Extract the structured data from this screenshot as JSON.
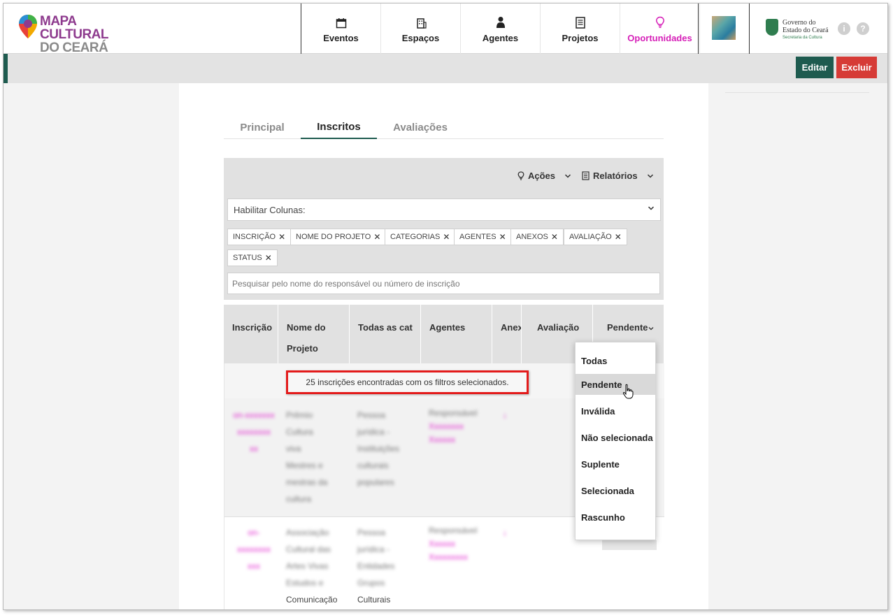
{
  "header": {
    "logo": {
      "line1": "MAPA CULTURAL",
      "line2": "DO CEARÁ"
    },
    "nav": [
      {
        "label": "Eventos",
        "icon": "calendar-icon"
      },
      {
        "label": "Espaços",
        "icon": "building-icon"
      },
      {
        "label": "Agentes",
        "icon": "person-icon"
      },
      {
        "label": "Projetos",
        "icon": "document-icon"
      },
      {
        "label": "Oportunidades",
        "icon": "lightbulb-icon",
        "active": true
      }
    ],
    "gov": {
      "line1": "Governo do",
      "line2": "Estado do Ceará",
      "line3": "Secretaria da Cultura"
    },
    "info_icon": "i",
    "help_icon": "?"
  },
  "actions": {
    "edit": "Editar",
    "delete": "Excluir"
  },
  "tabs": [
    {
      "label": "Principal"
    },
    {
      "label": "Inscritos",
      "active": true
    },
    {
      "label": "Avaliações"
    }
  ],
  "toolbar": {
    "actions": "Ações",
    "reports": "Relatórios"
  },
  "filters": {
    "columns_select": "Habilitar Colunas:",
    "chips": [
      "INSCRIÇÃO",
      "NOME DO PROJETO",
      "CATEGORIAS",
      "AGENTES",
      "ANEXOS",
      "AVALIAÇÃO",
      "STATUS"
    ],
    "search_placeholder": "Pesquisar pelo nome do responsável ou número de inscrição"
  },
  "table": {
    "headers": [
      "Inscrição",
      "Nome do Projeto",
      "Todas as cat",
      "Agentes",
      "Anex",
      "Avaliação",
      "Pendente"
    ],
    "result_text": "25 inscrições encontradas com os filtros selecionados.",
    "rows": [
      {
        "inscricao": [
          "on-xxxxxxx",
          "xxxxxxxx",
          "xx"
        ],
        "projeto": [
          "Prêmio",
          "Cultura",
          "viva",
          "Mestres e",
          "mestras da",
          "cultura"
        ],
        "categoria": [
          "Pessoa",
          "jurídica -",
          "Instituições",
          "culturais",
          "populares"
        ],
        "agentes": [
          "Responsável",
          "Xxxxxxxx",
          "Xxxxxx"
        ],
        "anexo": "↓"
      },
      {
        "inscricao": [
          "on-",
          "xxxxxxxx",
          "xxx"
        ],
        "projeto": [
          "Associação",
          "Cultural das",
          "Artes Vivas",
          "Estudos e",
          "Comunicação"
        ],
        "categoria": [
          "Pessoa",
          "jurídica -",
          "Entidades",
          "Grupos",
          "Culturais"
        ],
        "agentes": [
          "Responsável",
          "Xxxxxx",
          "Xxxxxxxxx"
        ],
        "anexo": "↓"
      }
    ]
  },
  "status_menu": {
    "options": [
      "Todas",
      "Pendente",
      "Inválida",
      "Não selecionada",
      "Suplente",
      "Selecionada",
      "Rascunho"
    ],
    "hovered": "Pendente"
  },
  "colors": {
    "accent": "#1e5b4f",
    "danger": "#d63b36",
    "active_nav": "#d61fb8",
    "link": "#e22bd0",
    "highlight_border": "#e31b1b"
  }
}
